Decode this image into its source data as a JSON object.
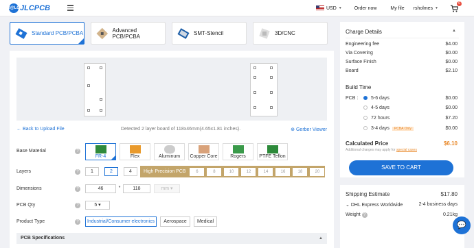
{
  "header": {
    "logo_text": "JLCPCB",
    "logo_mark": "J@LC",
    "currency": "USD",
    "order_now": "Order now",
    "my_file": "My file",
    "username": "rsholmes",
    "cart_count": "0"
  },
  "tabs": [
    {
      "label": "Standard PCB/PCBA"
    },
    {
      "label": "Advanced PCB/PCBA"
    },
    {
      "label": "SMT-Stencil"
    },
    {
      "label": "3D/CNC"
    }
  ],
  "preview": {
    "back_link": "Back to Upload File",
    "detected": "Detected 2 layer board of 118x46mm(4.65x1.81 inches).",
    "gerber_viewer": "Gerber Viewer"
  },
  "form": {
    "base_material_label": "Base Material",
    "materials": [
      "FR-4",
      "Flex",
      "Aluminum",
      "Copper Core",
      "Rogers",
      "PTFE Teflon"
    ],
    "layers_label": "Layers",
    "layers": [
      "1",
      "2",
      "4"
    ],
    "high_precision_label": "High Precision PCB",
    "hp_layers": [
      "6",
      "8",
      "10",
      "12",
      "14",
      "16",
      "18",
      "20"
    ],
    "dimensions_label": "Dimensions",
    "dim_x": "46",
    "dim_sep": "*",
    "dim_y": "118",
    "dim_unit": "mm",
    "qty_label": "PCB Qty",
    "qty_value": "5",
    "product_type_label": "Product Type",
    "product_types": [
      "Industrial/Consumer electronics",
      "Aerospace",
      "Medical"
    ],
    "specs_label": "PCB Specifications"
  },
  "charges": {
    "title": "Charge Details",
    "items": [
      {
        "label": "Engineering fee",
        "value": "$4.00"
      },
      {
        "label": "Via Covering",
        "value": "$0.00"
      },
      {
        "label": "Surface Finish",
        "value": "$0.00"
      },
      {
        "label": "Board",
        "value": "$2.10"
      }
    ],
    "build_time_title": "Build Time",
    "pcb_label": "PCB :",
    "build_options": [
      {
        "label": "5-6 days",
        "value": "$0.00"
      },
      {
        "label": "4-5 days",
        "value": "$0.00"
      },
      {
        "label": "72 hours",
        "value": "$7.20"
      },
      {
        "label": "3-4 days",
        "value": "$0.00"
      }
    ],
    "pcb_only_tag": "PCBA Only",
    "calculated_label": "Calculated Price",
    "calculated_value": "$6.10",
    "note": "Additional charges may apply for",
    "note_link": "special cases",
    "cart_button": "SAVE TO CART"
  },
  "shipping": {
    "title": "Shipping Estimate",
    "price": "$17.80",
    "method": "DHL Express Worldwide",
    "days": "2-4 business days",
    "weight_label": "Weight",
    "weight_value": "0.21kg"
  },
  "colors": {
    "accent": "#1e72d6",
    "price": "#e98a2c",
    "high_precision": "#c3a56a"
  }
}
